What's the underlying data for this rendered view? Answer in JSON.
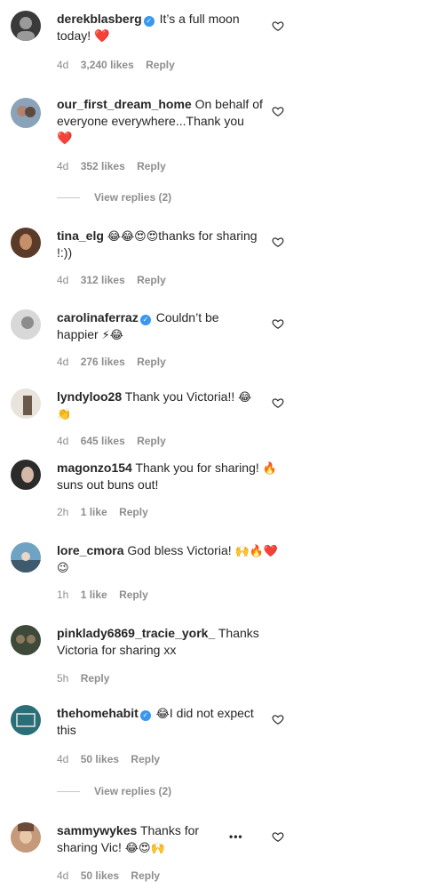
{
  "comments": [
    {
      "user": "derekblasberg",
      "verified": true,
      "text": "It’s a full moon today!",
      "emoji": "❤️",
      "time": "4d",
      "likes": "3,240 likes",
      "reply": "Reply",
      "avatar_color": "#3a3a3a",
      "avatar_accent": "#9a9a9a"
    },
    {
      "user": "our_first_dream_home",
      "verified": false,
      "text": "On behalf of everyone everywhere...Thank you",
      "emoji": "❤️",
      "time": "4d",
      "likes": "352 likes",
      "reply": "Reply",
      "view_replies": "View replies (2)",
      "avatar_color": "#8aa3b8",
      "avatar_accent": "#b08270"
    },
    {
      "user": "tina_elg",
      "verified": false,
      "lead_emoji": "😂😂😍😍",
      "text": "thanks for sharing !:))",
      "time": "4d",
      "likes": "312 likes",
      "reply": "Reply",
      "avatar_color": "#5a3b2a",
      "avatar_accent": "#c58f6a"
    },
    {
      "user": "carolinaferraz",
      "verified": true,
      "text": "Couldn’t be happier",
      "emoji": "⚡😂",
      "time": "4d",
      "likes": "276 likes",
      "reply": "Reply",
      "avatar_color": "#d8d8d8",
      "avatar_accent": "#8c8c8c"
    },
    {
      "user": "lyndyloo28",
      "verified": false,
      "text": "Thank you Victoria!!",
      "emoji": "😂👏",
      "time": "4d",
      "likes": "645 likes",
      "reply": "Reply",
      "avatar_color": "#e8e4dc",
      "avatar_accent": "#6b5a4a"
    },
    {
      "user": "magonzo154",
      "verified": false,
      "text": "Thank you for sharing!",
      "emoji": "🔥",
      "text2": "suns out buns out!",
      "time": "2h",
      "likes": "1 like",
      "reply": "Reply",
      "avatar_color": "#2b2b2b",
      "avatar_accent": "#d4b8a8"
    },
    {
      "user": "lore_cmora",
      "verified": false,
      "text": "God bless Victoria!",
      "emoji": "🙌🔥❤️😉",
      "time": "1h",
      "likes": "1 like",
      "reply": "Reply",
      "avatar_color": "#6fa3c4",
      "avatar_accent": "#3d5a6e"
    },
    {
      "user": "pinklady6869_tracie_york_",
      "verified": false,
      "text": "Thanks Victoria for sharing xx",
      "time": "5h",
      "reply": "Reply",
      "avatar_color": "#3d4a3a",
      "avatar_accent": "#8b7a60"
    },
    {
      "user": "thehomehabit",
      "verified": true,
      "lead_emoji": "😂",
      "text": "I did not expect this",
      "time": "4d",
      "likes": "50 likes",
      "reply": "Reply",
      "view_replies": "View replies (2)",
      "avatar_color": "#2a6e78",
      "avatar_accent": "#e8e8e8"
    },
    {
      "user": "sammywykes",
      "verified": false,
      "text": "Thanks for sharing Vic!",
      "emoji": "😂😍🙌",
      "time": "4d",
      "likes": "50 likes",
      "reply": "Reply",
      "more": "•••",
      "avatar_color": "#c49a7a",
      "avatar_accent": "#6b4a3a"
    }
  ]
}
